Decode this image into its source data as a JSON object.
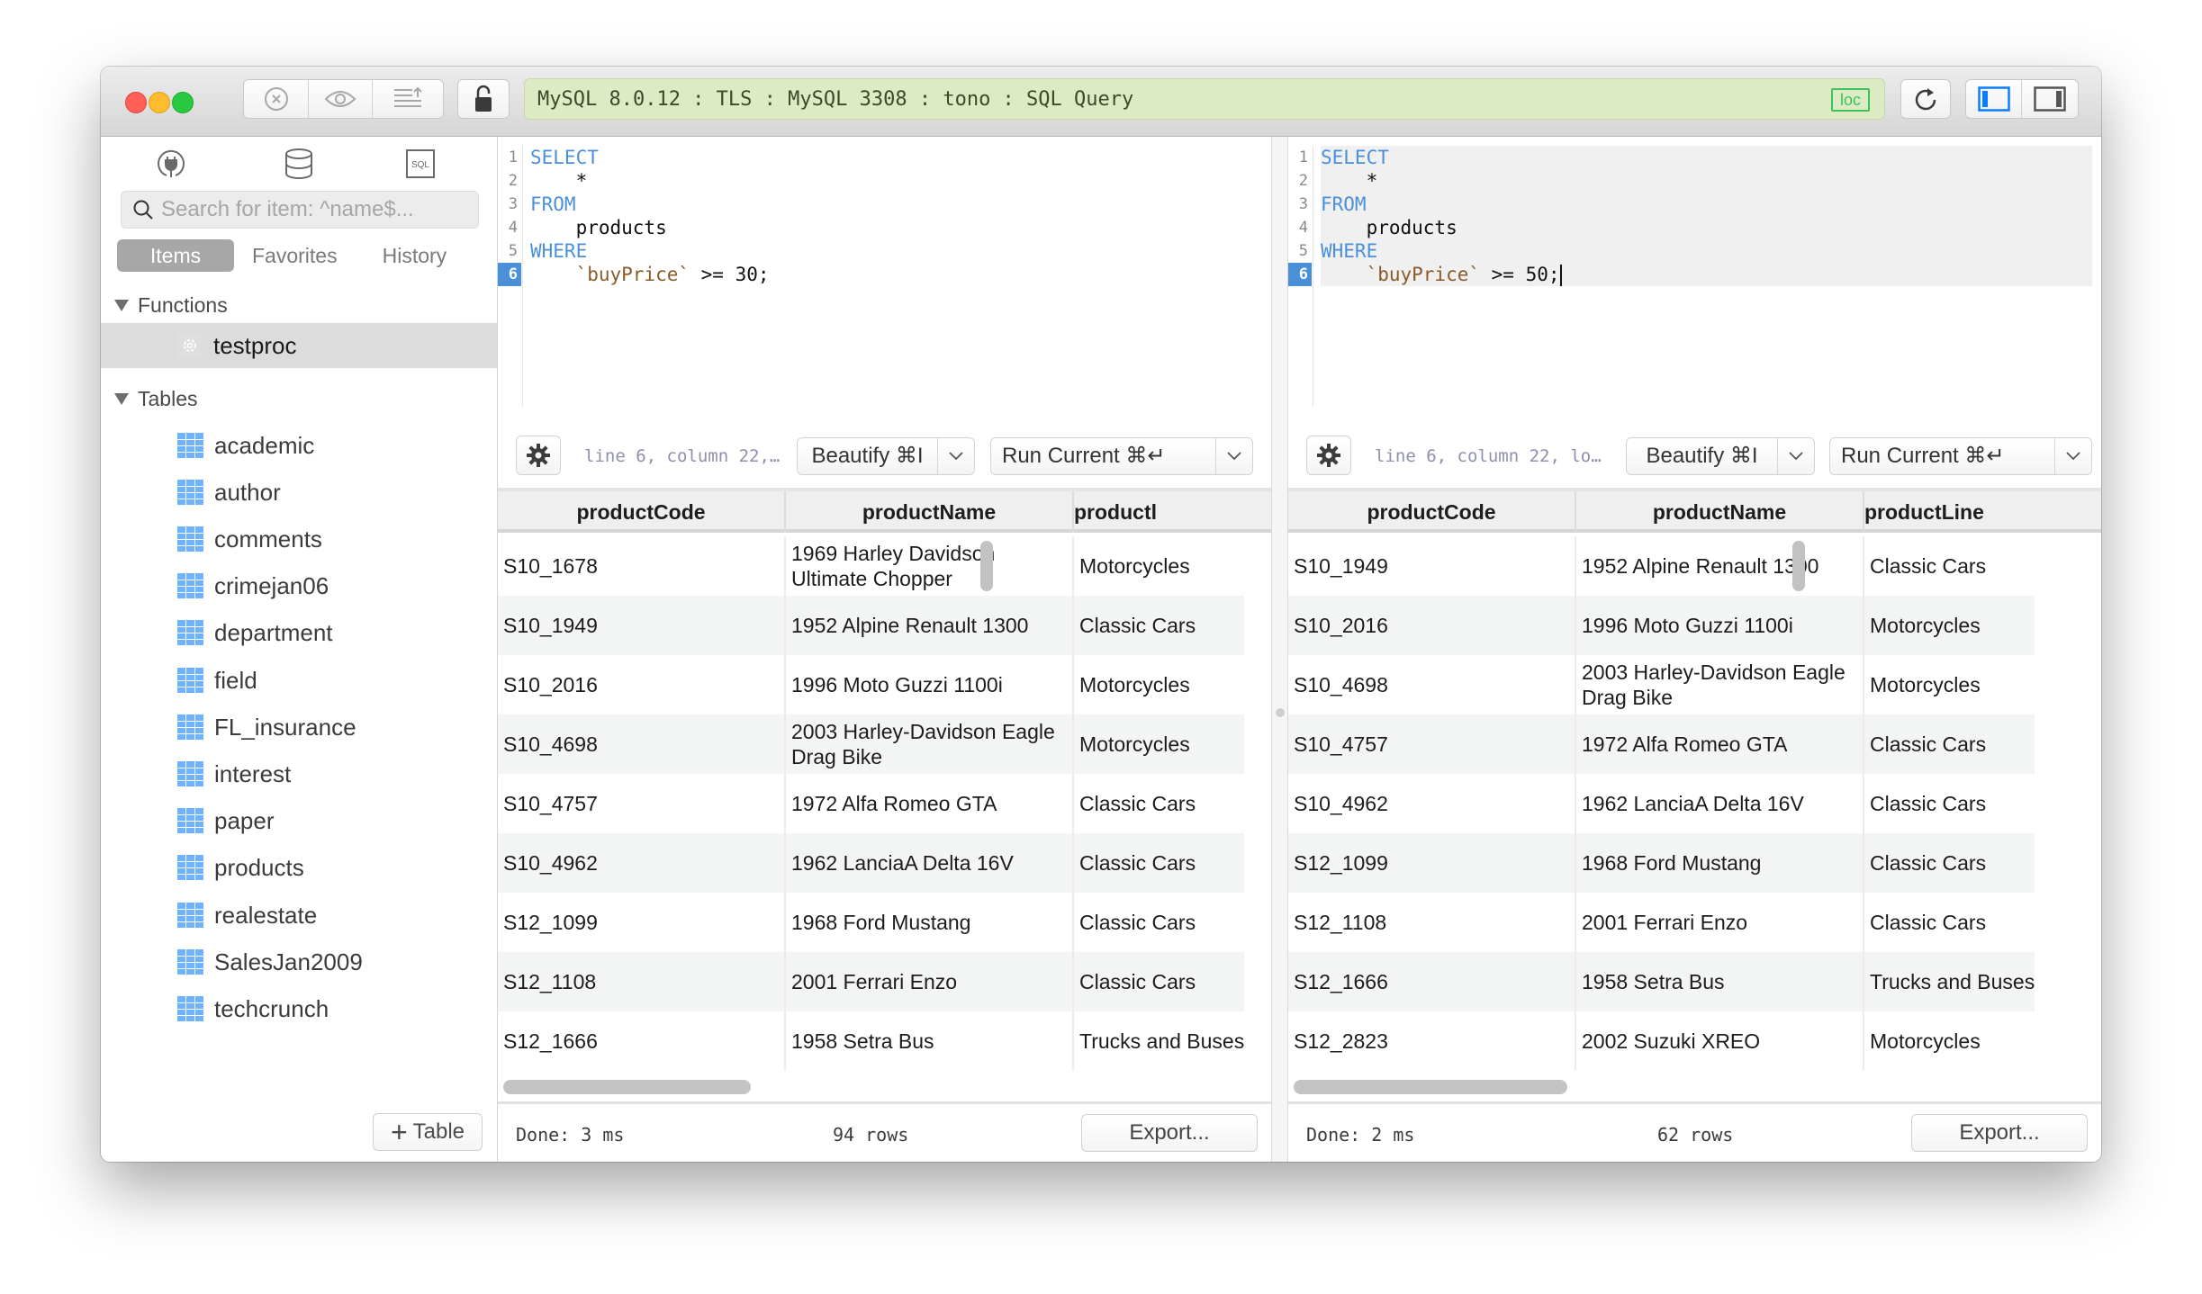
{
  "titlebar": {
    "address": "MySQL 8.0.12 : TLS : MySQL 3308 : tono : SQL Query",
    "badge": "loc",
    "icons": [
      "close-circle-icon",
      "eye-icon",
      "export-list-icon",
      "lock-open-icon",
      "refresh-icon",
      "sidebar-left-icon",
      "sidebar-right-icon"
    ]
  },
  "colors": {
    "address_bg": "#dcebc3",
    "badge": "#3cc35a",
    "keyword": "#4a90d9",
    "identifier": "#8b5a2b",
    "table_icon": "#6fb3ff",
    "accent": "#0a7cff"
  },
  "sidebar": {
    "top_icons": [
      "plug-icon",
      "database-icon",
      "sql-file-icon"
    ],
    "search_placeholder": "Search for item: ^name$...",
    "segments": [
      "Items",
      "Favorites",
      "History"
    ],
    "active_segment": "Items",
    "functions_header": "Functions",
    "functions": [
      "testproc"
    ],
    "tables_header": "Tables",
    "tables": [
      "academic",
      "author",
      "comments",
      "crimejan06",
      "department",
      "field",
      "FL_insurance",
      "interest",
      "paper",
      "products",
      "realestate",
      "SalesJan2009",
      "techcrunch"
    ],
    "add_table_label": "Table"
  },
  "panes": [
    {
      "code": {
        "lines": [
          {
            "n": "1",
            "parts": [
              {
                "t": "SELECT",
                "c": "kw"
              }
            ]
          },
          {
            "n": "2",
            "parts": [
              {
                "t": "    *",
                "c": ""
              }
            ]
          },
          {
            "n": "3",
            "parts": [
              {
                "t": "FROM",
                "c": "kw"
              }
            ]
          },
          {
            "n": "4",
            "parts": [
              {
                "t": "    products",
                "c": ""
              }
            ]
          },
          {
            "n": "5",
            "parts": [
              {
                "t": "WHERE",
                "c": "kw"
              }
            ]
          },
          {
            "n": "6",
            "parts": [
              {
                "t": "    ",
                "c": ""
              },
              {
                "t": "`buyPrice`",
                "c": "str"
              },
              {
                "t": " >= 30;",
                "c": ""
              }
            ]
          }
        ],
        "current_line": "6"
      },
      "cursor_status": "line 6, column 22,…",
      "beautify_label": "Beautify ⌘I",
      "run_label": "Run Current ⌘↵",
      "columns": [
        "productCode",
        "productName",
        "productl"
      ],
      "rows": [
        [
          "S10_1678",
          "1969 Harley Davidson Ultimate Chopper",
          "Motorcycles"
        ],
        [
          "S10_1949",
          "1952 Alpine Renault 1300",
          "Classic Cars"
        ],
        [
          "S10_2016",
          "1996 Moto Guzzi 1100i",
          "Motorcycles"
        ],
        [
          "S10_4698",
          "2003 Harley-Davidson Eagle Drag Bike",
          "Motorcycles"
        ],
        [
          "S10_4757",
          "1972 Alfa Romeo GTA",
          "Classic Cars"
        ],
        [
          "S10_4962",
          "1962 LanciaA Delta 16V",
          "Classic Cars"
        ],
        [
          "S12_1099",
          "1968 Ford Mustang",
          "Classic Cars"
        ],
        [
          "S12_1108",
          "2001 Ferrari Enzo",
          "Classic Cars"
        ],
        [
          "S12_1666",
          "1958 Setra Bus",
          "Trucks and Buses"
        ]
      ],
      "status": "Done: 3 ms",
      "row_count": "94 rows",
      "export_label": "Export..."
    },
    {
      "code": {
        "lines": [
          {
            "n": "1",
            "parts": [
              {
                "t": "SELECT",
                "c": "kw"
              }
            ]
          },
          {
            "n": "2",
            "parts": [
              {
                "t": "    *",
                "c": ""
              }
            ]
          },
          {
            "n": "3",
            "parts": [
              {
                "t": "FROM",
                "c": "kw"
              }
            ]
          },
          {
            "n": "4",
            "parts": [
              {
                "t": "    products",
                "c": ""
              }
            ]
          },
          {
            "n": "5",
            "parts": [
              {
                "t": "WHERE",
                "c": "kw"
              }
            ]
          },
          {
            "n": "6",
            "parts": [
              {
                "t": "    ",
                "c": ""
              },
              {
                "t": "`buyPrice`",
                "c": "str"
              },
              {
                "t": " >= 50;",
                "c": ""
              }
            ]
          }
        ],
        "current_line": "6"
      },
      "cursor_status": "line 6, column 22, lo…",
      "beautify_label": "Beautify ⌘I",
      "run_label": "Run Current ⌘↵",
      "columns": [
        "productCode",
        "productName",
        "productLine"
      ],
      "rows": [
        [
          "S10_1949",
          "1952 Alpine Renault 1300",
          "Classic Cars"
        ],
        [
          "S10_2016",
          "1996 Moto Guzzi 1100i",
          "Motorcycles"
        ],
        [
          "S10_4698",
          "2003 Harley-Davidson Eagle Drag Bike",
          "Motorcycles"
        ],
        [
          "S10_4757",
          "1972 Alfa Romeo GTA",
          "Classic Cars"
        ],
        [
          "S10_4962",
          "1962 LanciaA Delta 16V",
          "Classic Cars"
        ],
        [
          "S12_1099",
          "1968 Ford Mustang",
          "Classic Cars"
        ],
        [
          "S12_1108",
          "2001 Ferrari Enzo",
          "Classic Cars"
        ],
        [
          "S12_1666",
          "1958 Setra Bus",
          "Trucks and Buses"
        ],
        [
          "S12_2823",
          "2002 Suzuki XREO",
          "Motorcycles"
        ]
      ],
      "status": "Done: 2 ms",
      "row_count": "62 rows",
      "export_label": "Export..."
    }
  ]
}
